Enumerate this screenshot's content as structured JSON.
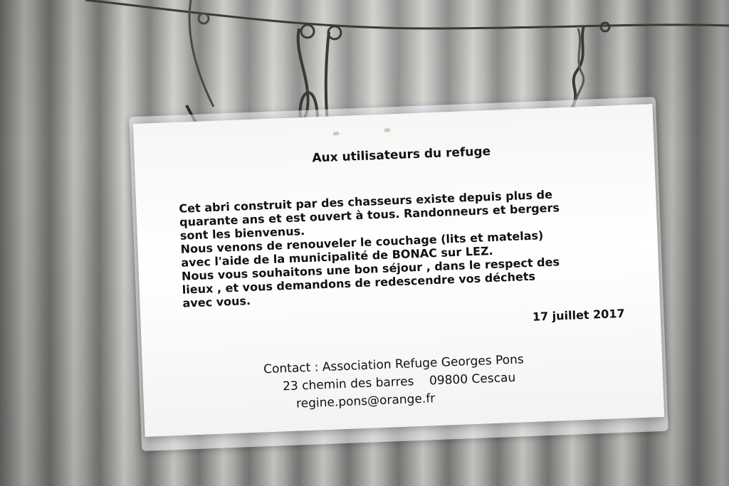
{
  "notice": {
    "title": "Aux utilisateurs du refuge",
    "body_lines": [
      "Cet abri construit par des chasseurs existe depuis plus de",
      "quarante ans et est ouvert à tous. Randonneurs et bergers",
      "sont les bienvenus.",
      "Nous venons de renouveler le couchage (lits et matelas)",
      "avec l'aide de la municipalité de BONAC sur LEZ.",
      "Nous vous souhaitons une bon séjour , dans le respect des",
      "lieux , et  vous demandons  de redescendre vos déchets",
      "avec vous."
    ],
    "date": "17 juillet 2017"
  },
  "contact": {
    "line1": "Contact : Association Refuge Georges Pons",
    "line2": "23 chemin des barres    09800 Cescau",
    "line3": "regine.pons@orange.fr"
  },
  "colors": {
    "paper": "#ffffff",
    "text": "#111111",
    "metal": "#a9a9a6",
    "wire": "#3a3a36"
  }
}
